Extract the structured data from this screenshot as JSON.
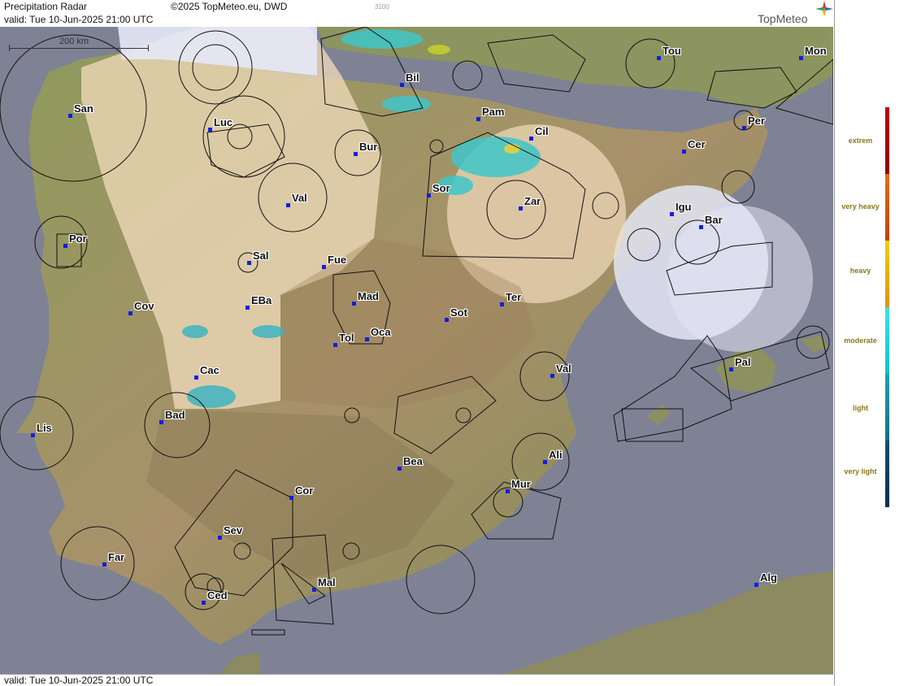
{
  "header": {
    "title": "Precipitation Radar",
    "copyright": "©2025 TopMeteo.eu, DWD",
    "code": "3100",
    "valid": "valid:  Tue  10-Jun-2025 21:00 UTC",
    "logo": "TopMeteo"
  },
  "scale": {
    "label": "200 km"
  },
  "footer": {
    "valid": "valid:  Tue  10-Jun-2025 21:00 UTC"
  },
  "legend": {
    "items": [
      {
        "label": "extrem",
        "colors": [
          "#c00000",
          "#8a0000"
        ]
      },
      {
        "label": "very heavy",
        "colors": [
          "#e07010",
          "#c04000"
        ]
      },
      {
        "label": "heavy",
        "colors": [
          "#f0d000",
          "#e09000"
        ]
      },
      {
        "label": "moderate",
        "colors": [
          "#40e0e8",
          "#10c0c8"
        ]
      },
      {
        "label": "light",
        "colors": [
          "#20a0b0",
          "#107080"
        ]
      },
      {
        "label": "very light",
        "colors": [
          "#105070",
          "#0a3048"
        ]
      }
    ]
  },
  "cities": [
    {
      "name": "San",
      "icon": "airport-marker"
    },
    {
      "name": "Luc",
      "icon": "airport-marker"
    },
    {
      "name": "Bil",
      "icon": "airport-marker"
    },
    {
      "name": "Tou",
      "icon": "airport-marker"
    },
    {
      "name": "Mon",
      "icon": "airport-marker"
    },
    {
      "name": "Pam",
      "icon": "airport-marker"
    },
    {
      "name": "Cil",
      "icon": "airport-marker"
    },
    {
      "name": "Per",
      "icon": "airport-marker"
    },
    {
      "name": "Bur",
      "icon": "airport-marker"
    },
    {
      "name": "Cer",
      "icon": "airport-marker"
    },
    {
      "name": "Sor",
      "icon": "airport-marker"
    },
    {
      "name": "Val",
      "icon": "airport-marker"
    },
    {
      "name": "Zar",
      "icon": "airport-marker"
    },
    {
      "name": "Igu",
      "icon": "airport-marker"
    },
    {
      "name": "Bar",
      "icon": "airport-marker"
    },
    {
      "name": "Por",
      "icon": "airport-marker"
    },
    {
      "name": "Sal",
      "icon": "airport-marker"
    },
    {
      "name": "Fue",
      "icon": "airport-marker"
    },
    {
      "name": "Mad",
      "icon": "airport-marker"
    },
    {
      "name": "Ter",
      "icon": "airport-marker"
    },
    {
      "name": "Cov",
      "icon": "airport-marker"
    },
    {
      "name": "EBa",
      "icon": "airport-marker"
    },
    {
      "name": "Sot",
      "icon": "airport-marker"
    },
    {
      "name": "Tol",
      "icon": "airport-marker"
    },
    {
      "name": "Oca",
      "icon": "airport-marker"
    },
    {
      "name": "Pal",
      "icon": "airport-marker"
    },
    {
      "name": "Cac",
      "icon": "airport-marker"
    },
    {
      "name": "Val",
      "icon": "airport-marker"
    },
    {
      "name": "Lis",
      "icon": "airport-marker"
    },
    {
      "name": "Bad",
      "icon": "airport-marker"
    },
    {
      "name": "Ali",
      "icon": "airport-marker"
    },
    {
      "name": "Bea",
      "icon": "airport-marker"
    },
    {
      "name": "Mur",
      "icon": "airport-marker"
    },
    {
      "name": "Cor",
      "icon": "airport-marker"
    },
    {
      "name": "Sev",
      "icon": "airport-marker"
    },
    {
      "name": "Far",
      "icon": "airport-marker"
    },
    {
      "name": "Alg",
      "icon": "airport-marker"
    },
    {
      "name": "Mal",
      "icon": "airport-marker"
    },
    {
      "name": "Ced",
      "icon": "airport-marker"
    }
  ]
}
